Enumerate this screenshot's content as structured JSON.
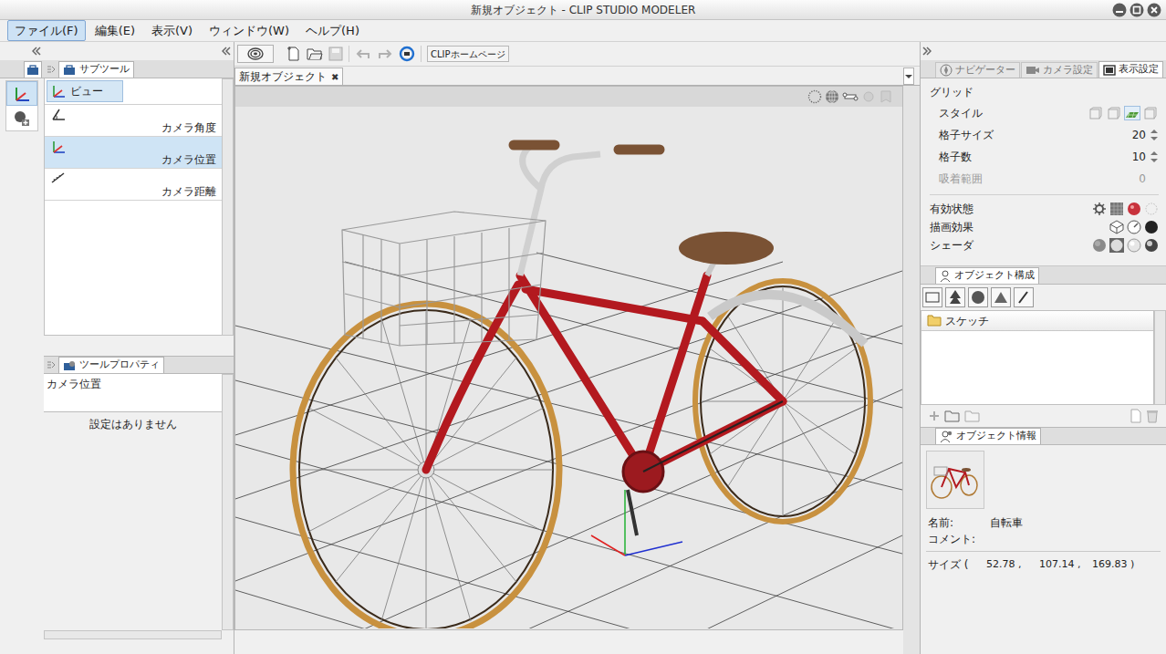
{
  "window": {
    "title": "新規オブジェクト - CLIP STUDIO MODELER"
  },
  "menu": [
    {
      "label": "ファイル(F)",
      "selected": true
    },
    {
      "label": "編集(E)",
      "selected": false
    },
    {
      "label": "表示(V)",
      "selected": false
    },
    {
      "label": "ウィンドウ(W)",
      "selected": false
    },
    {
      "label": "ヘルプ(H)",
      "selected": false
    }
  ],
  "tools": [
    {
      "selected": true
    },
    {
      "selected": false
    }
  ],
  "subtool": {
    "tab": "サブツール",
    "group": "ビュー",
    "items": [
      {
        "label": "カメラ角度",
        "selected": false
      },
      {
        "label": "カメラ位置",
        "selected": true
      },
      {
        "label": "カメラ距離",
        "selected": false
      }
    ]
  },
  "tool_property": {
    "tab": "ツールプロパティ",
    "title": "カメラ位置",
    "message": "設定はありません"
  },
  "toolbar": {
    "homepage": "CLIPホームページ"
  },
  "document_tab": {
    "label": "新規オブジェクト",
    "close": "✖"
  },
  "right_tabs": [
    {
      "label": "ナビゲーター",
      "selected": false
    },
    {
      "label": "カメラ設定",
      "selected": false
    },
    {
      "label": "表示設定",
      "selected": true
    }
  ],
  "grid": {
    "title": "グリッド",
    "rows": [
      {
        "label": "スタイル",
        "kind": "style",
        "value": "",
        "disabled": false
      },
      {
        "label": "格子サイズ",
        "kind": "spinner",
        "value": "20",
        "disabled": false
      },
      {
        "label": "格子数",
        "kind": "spinner",
        "value": "10",
        "disabled": false
      },
      {
        "label": "吸着範囲",
        "kind": "plain",
        "value": "0",
        "disabled": true
      }
    ],
    "styles": [
      {
        "selected": false
      },
      {
        "selected": false
      },
      {
        "selected": true
      },
      {
        "selected": false
      }
    ]
  },
  "render_rows": [
    {
      "label": "有効状態"
    },
    {
      "label": "描画効果"
    },
    {
      "label": "シェーダ"
    }
  ],
  "object_structure": {
    "tab": "オブジェクト構成",
    "items": [
      {
        "label": "スケッチ",
        "selected": false
      }
    ]
  },
  "object_info": {
    "tab": "オブジェクト情報",
    "name_label": "名前:",
    "name": "自転車",
    "comment_label": "コメント:",
    "size_label": "サイズ (",
    "size": [
      "52.78 ,",
      "107.14 ,",
      "169.83 )"
    ]
  }
}
